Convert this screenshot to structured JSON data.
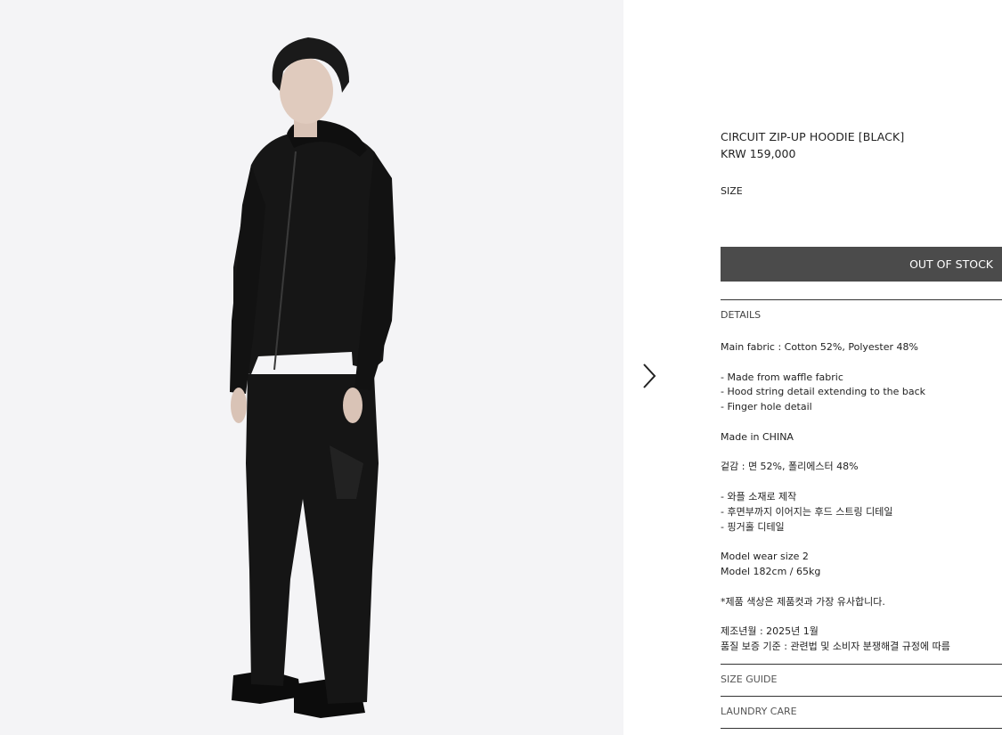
{
  "product": {
    "title": "CIRCUIT ZIP-UP HOODIE [BLACK]",
    "price": "KRW 159,000",
    "size_label": "SIZE",
    "stock_button": "OUT OF STOCK"
  },
  "sections": {
    "details": "DETAILS",
    "size_guide": "SIZE GUIDE",
    "laundry_care": "LAUNDRY CARE"
  },
  "details_text": {
    "fabric": "Main fabric : Cotton 52%, Polyester 48%",
    "bullets": [
      "- Made from waffle fabric",
      "- Hood string detail extending to the back",
      "- Finger hole detail"
    ],
    "origin": "Made in CHINA",
    "fabric_kr": "겉감 : 면 52%, 폴리에스터 48%",
    "bullets_kr": [
      "- 와플 소재로 제작",
      "- 후면부까지 이어지는 후드 스트링 디테일",
      "- 핑거홀 디테일"
    ],
    "model_size": "Model wear size 2",
    "model_body": "Model 182cm / 65kg",
    "color_note": "*제품 색상은 제품컷과 가장 유사합니다.",
    "manufacture_date": "제조년월 : 2025년 1월",
    "quality_standard": "품질 보증 기준 : 관련법 및 소비자 분쟁해결 규정에 따름"
  },
  "icons": {
    "next": "chevron-right-icon"
  },
  "colors": {
    "button_bg": "#4b4b4b",
    "button_text": "#ffffff",
    "photo_bg": "#f4f4f6",
    "garment": "#141414"
  }
}
